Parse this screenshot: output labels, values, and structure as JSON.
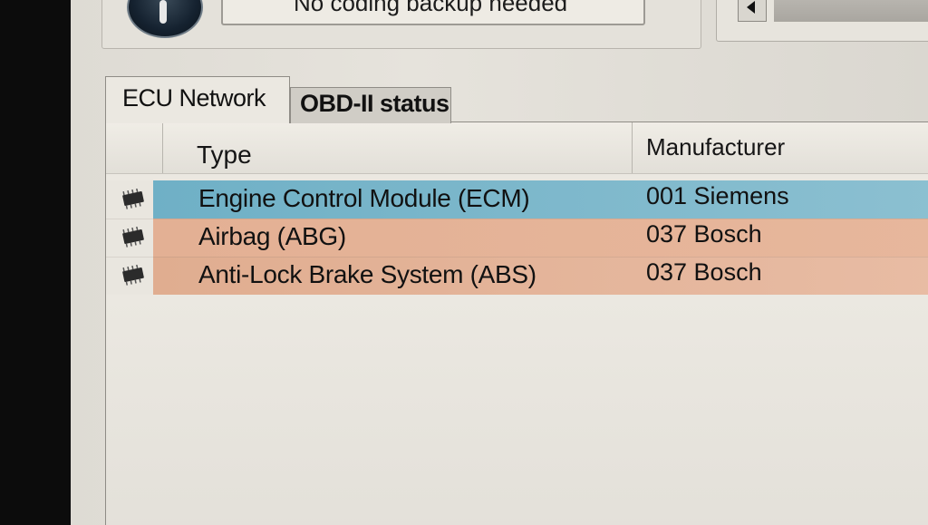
{
  "top": {
    "coding_status": "No coding backup needed"
  },
  "tabs": [
    {
      "label": "ECU Network",
      "active": true
    },
    {
      "label": "OBD-II status",
      "active": false
    }
  ],
  "table": {
    "columns": [
      "Type",
      "Manufacturer"
    ],
    "rows": [
      {
        "type": "Engine Control Module (ECM)",
        "manufacturer": "001 Siemens",
        "icon": "ecu-chip-icon",
        "color": "#79b4c8"
      },
      {
        "type": "Airbag (ABG)",
        "manufacturer": "037 Bosch",
        "icon": "ecu-chip-icon",
        "color": "#e3b094"
      },
      {
        "type": "Anti-Lock Brake System (ABS)",
        "manufacturer": "037 Bosch",
        "icon": "ecu-chip-icon",
        "color": "#e3b094"
      }
    ]
  },
  "colors": {
    "selected_row": "#79b4c8",
    "module_row": "#e3b094",
    "window_bg": "#e4e1da"
  }
}
